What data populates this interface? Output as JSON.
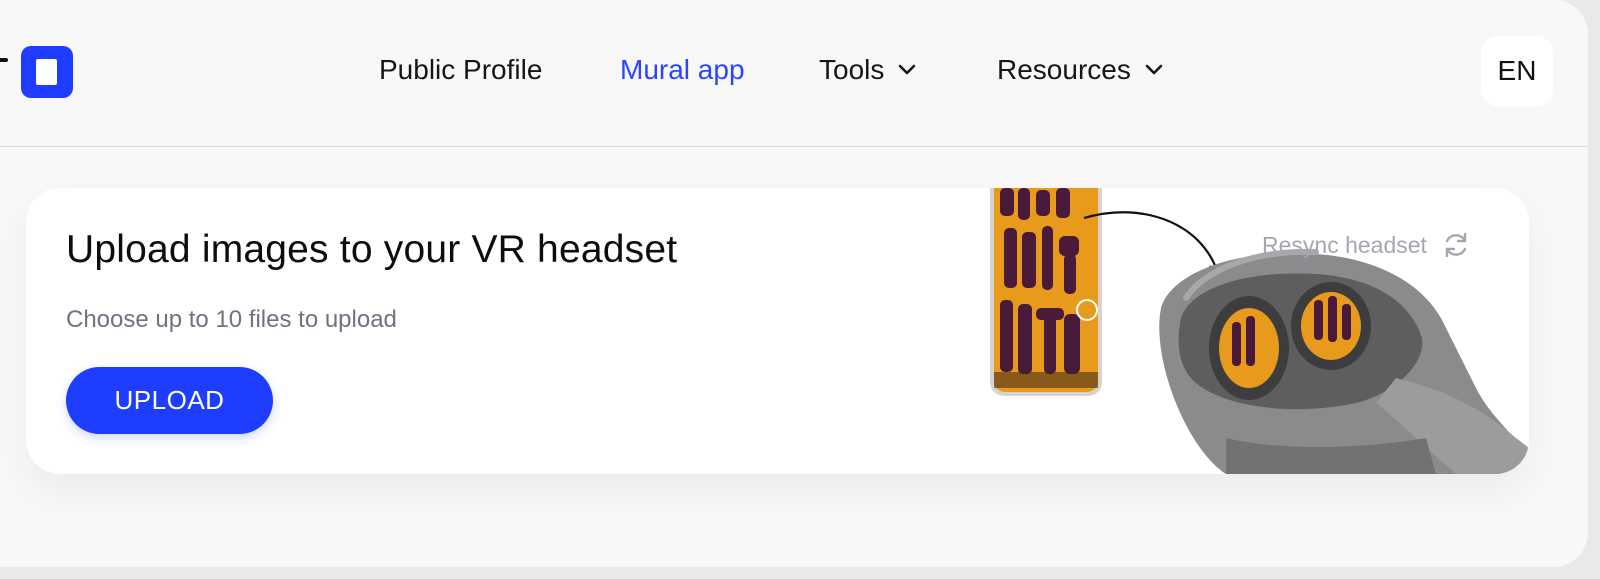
{
  "header": {
    "nav": [
      {
        "label": "Public Profile",
        "active": false,
        "dropdown": false
      },
      {
        "label": "Mural app",
        "active": true,
        "dropdown": false
      },
      {
        "label": "Tools",
        "active": false,
        "dropdown": true
      },
      {
        "label": "Resources",
        "active": false,
        "dropdown": true
      }
    ],
    "language": "EN"
  },
  "card": {
    "title": "Upload images to your VR headset",
    "subtitle": "Choose up to 10 files to upload",
    "upload_label": "UPLOAD",
    "resync_label": "Resync headset"
  },
  "colors": {
    "accent": "#1f3dff",
    "active_nav": "#2b44ff",
    "phone_screen": "#e79a1c",
    "lettering": "#4a1a3a",
    "headset": "#7a7a7c"
  },
  "icons": [
    "logo-icon",
    "chevron-down-icon",
    "refresh-icon",
    "arrow-icon"
  ]
}
